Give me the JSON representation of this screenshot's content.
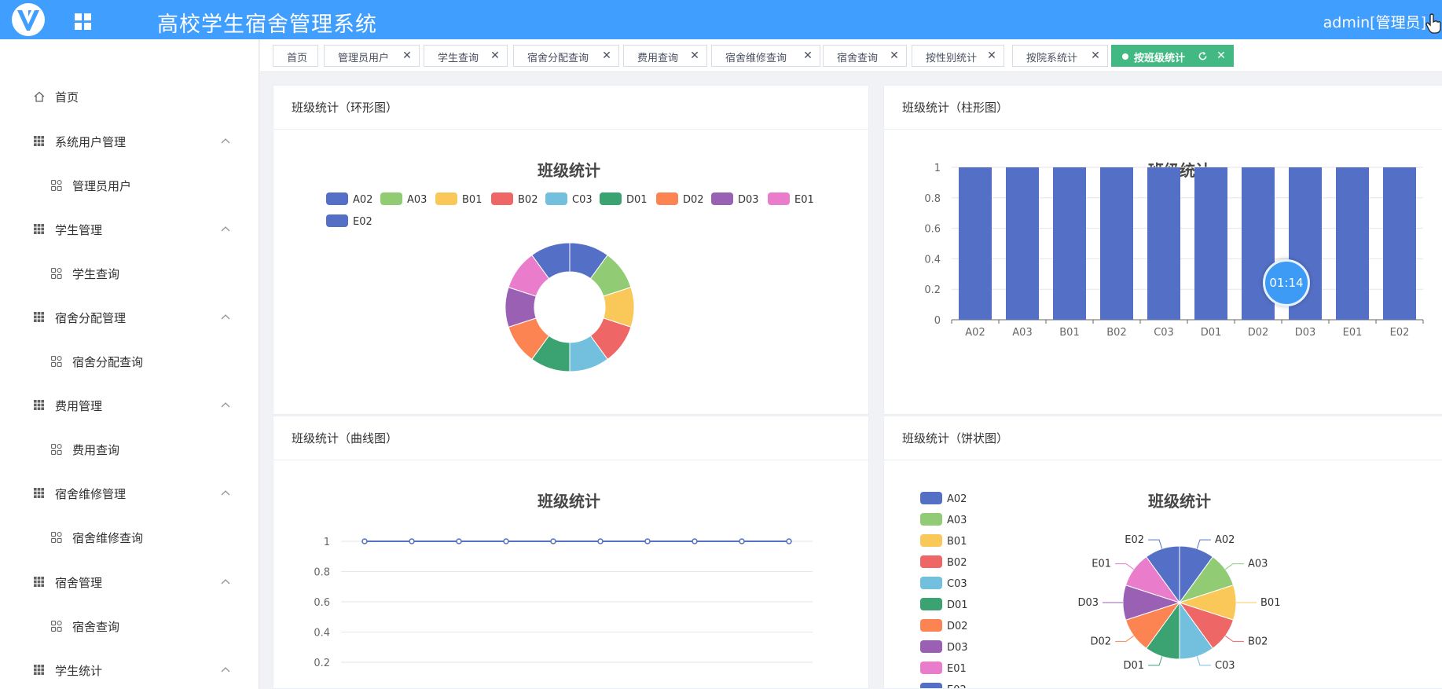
{
  "app": {
    "title": "高校学生宿舍管理系统",
    "user": "admin[管理员]"
  },
  "sidebar": {
    "items": [
      {
        "label": "首页",
        "icon": "home-icon",
        "level": 1
      },
      {
        "label": "系统用户管理",
        "icon": "grid-icon",
        "level": 1,
        "expanded": true
      },
      {
        "label": "管理员用户",
        "icon": "apps-icon",
        "level": 2
      },
      {
        "label": "学生管理",
        "icon": "grid-icon",
        "level": 1,
        "expanded": true
      },
      {
        "label": "学生查询",
        "icon": "apps-icon",
        "level": 2
      },
      {
        "label": "宿舍分配管理",
        "icon": "grid-icon",
        "level": 1,
        "expanded": true
      },
      {
        "label": "宿舍分配查询",
        "icon": "apps-icon",
        "level": 2
      },
      {
        "label": "费用管理",
        "icon": "grid-icon",
        "level": 1,
        "expanded": true
      },
      {
        "label": "费用查询",
        "icon": "apps-icon",
        "level": 2
      },
      {
        "label": "宿舍维修管理",
        "icon": "grid-icon",
        "level": 1,
        "expanded": true
      },
      {
        "label": "宿舍维修查询",
        "icon": "apps-icon",
        "level": 2
      },
      {
        "label": "宿舍管理",
        "icon": "grid-icon",
        "level": 1,
        "expanded": true
      },
      {
        "label": "宿舍查询",
        "icon": "apps-icon",
        "level": 2
      },
      {
        "label": "学生统计",
        "icon": "grid-icon",
        "level": 1,
        "expanded": true
      }
    ]
  },
  "tabs": [
    {
      "label": "首页",
      "closable": false
    },
    {
      "label": "管理员用户",
      "closable": true
    },
    {
      "label": "学生查询",
      "closable": true
    },
    {
      "label": "宿舍分配查询",
      "closable": true
    },
    {
      "label": "费用查询",
      "closable": true
    },
    {
      "label": "宿舍维修查询",
      "closable": true
    },
    {
      "label": "宿舍查询",
      "closable": true
    },
    {
      "label": "按性别统计",
      "closable": true
    },
    {
      "label": "按院系统计",
      "closable": true
    },
    {
      "label": "按班级统计",
      "closable": true,
      "active": true
    }
  ],
  "cards": {
    "donut": "班级统计（环形图）",
    "bar": "班级统计（柱形图）",
    "line": "班级统计（曲线图）",
    "pie": "班级统计（饼状图）"
  },
  "timer": "01:14",
  "colors": {
    "header": "#409eff",
    "active_tab": "#42b983",
    "palette": [
      "#5470c6",
      "#91cc75",
      "#fac858",
      "#ee6666",
      "#73c0de",
      "#3ba272",
      "#fc8452",
      "#9a60b4",
      "#ea7ccc",
      "#5470c6"
    ]
  },
  "chart_data": [
    {
      "type": "pie",
      "variant": "donut",
      "title": "班级统计",
      "categories": [
        "A02",
        "A03",
        "B01",
        "B02",
        "C03",
        "D01",
        "D02",
        "D03",
        "E01",
        "E02"
      ],
      "values": [
        1,
        1,
        1,
        1,
        1,
        1,
        1,
        1,
        1,
        1
      ],
      "legend": "top"
    },
    {
      "type": "bar",
      "title": "班级统计",
      "categories": [
        "A02",
        "A03",
        "B01",
        "B02",
        "C03",
        "D01",
        "D02",
        "D03",
        "E01",
        "E02"
      ],
      "values": [
        1,
        1,
        1,
        1,
        1,
        1,
        1,
        1,
        1,
        1
      ],
      "ylim": [
        0,
        1
      ],
      "yticks": [
        "0",
        "0.2",
        "0.4",
        "0.6",
        "0.8",
        "1"
      ],
      "grid": true
    },
    {
      "type": "line",
      "title": "班级统计",
      "categories": [
        "A02",
        "A03",
        "B01",
        "B02",
        "C03",
        "D01",
        "D02",
        "D03",
        "E01",
        "E02"
      ],
      "values": [
        1,
        1,
        1,
        1,
        1,
        1,
        1,
        1,
        1,
        1
      ],
      "ylim": [
        0,
        1
      ],
      "yticks": [
        "0.2",
        "0.4",
        "0.6",
        "0.8",
        "1"
      ],
      "grid": true
    },
    {
      "type": "pie",
      "title": "班级统计",
      "categories": [
        "A02",
        "A03",
        "B01",
        "B02",
        "C03",
        "D01",
        "D02",
        "D03",
        "E01",
        "E02"
      ],
      "values": [
        1,
        1,
        1,
        1,
        1,
        1,
        1,
        1,
        1,
        1
      ],
      "legend": "left"
    }
  ]
}
